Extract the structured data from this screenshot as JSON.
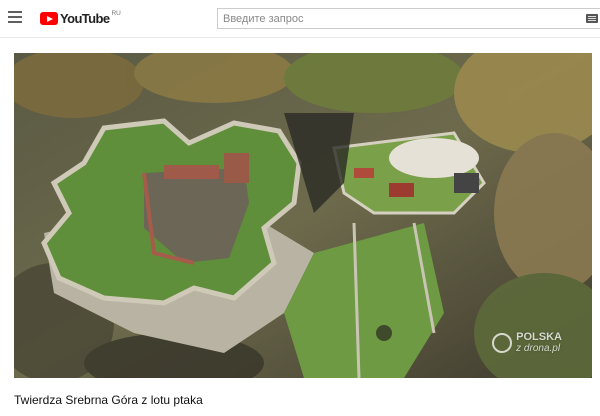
{
  "header": {
    "logo_text": "YouTube",
    "region_code": "RU",
    "search_placeholder": "Введите запрос",
    "icons": [
      "menu-icon",
      "youtube-logo-icon",
      "keyboard-icon"
    ]
  },
  "video": {
    "title": "Twierdza Srebrna Góra z lotu ptaka",
    "watermark_main": "POLSKA",
    "watermark_sub": "z drona.pl"
  },
  "colors": {
    "brand_red": "#ff0000",
    "grass": "#5f8f3a",
    "stone": "#b9b3a3"
  }
}
